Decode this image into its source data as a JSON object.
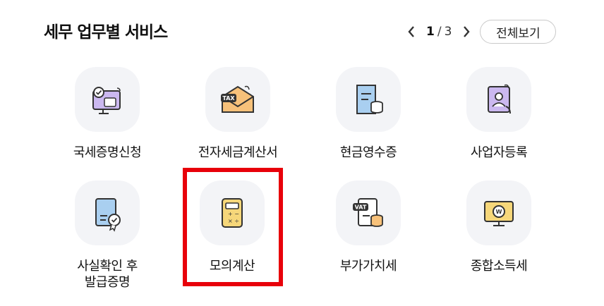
{
  "section": {
    "title": "세무 업무별 서비스"
  },
  "pager": {
    "current": "1",
    "separator": "/",
    "total": "3",
    "view_all": "전체보기"
  },
  "services": [
    {
      "label": "국세증명신청",
      "icon": "monitor-certificate-icon"
    },
    {
      "label": "전자세금계산서",
      "icon": "tax-envelope-icon"
    },
    {
      "label": "현금영수증",
      "icon": "receipt-coins-icon"
    },
    {
      "label": "사업자등록",
      "icon": "person-document-icon"
    },
    {
      "label_line1": "사실확인 후",
      "label_line2": "발급증명",
      "icon": "certificate-seal-icon"
    },
    {
      "label": "모의계산",
      "icon": "calculator-icon"
    },
    {
      "label": "부가가치세",
      "icon": "vat-document-icon"
    },
    {
      "label": "종합소득세",
      "icon": "monitor-won-icon"
    }
  ],
  "colors": {
    "highlight": "#e8000a",
    "icon_bg": "#f3f4f7",
    "accent_blue": "#a9cff0",
    "accent_orange": "#f7c17a",
    "accent_purple": "#cbb8f0",
    "accent_yellow": "#f6d77a"
  }
}
